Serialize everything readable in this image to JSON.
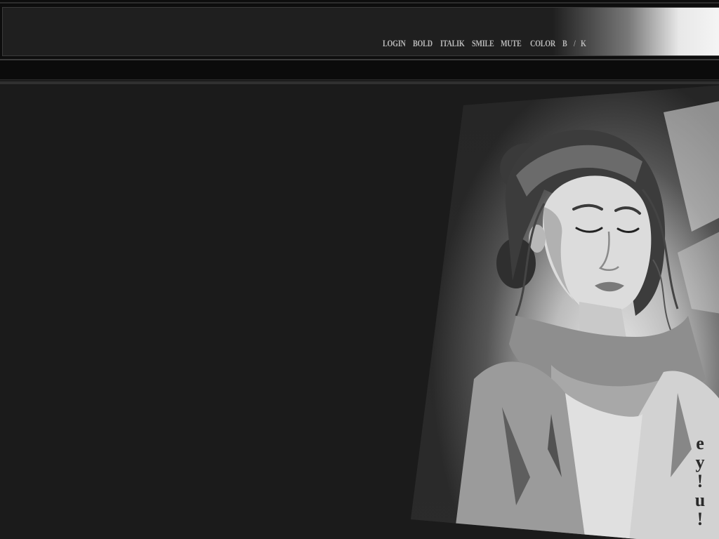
{
  "toolbar": {
    "login": "LOGIN",
    "bold": "BOLD",
    "italik": "ITALIK",
    "smile": "SMILE",
    "mute": "MUTE",
    "color": "COLOR",
    "b": "B",
    "slash": "/",
    "k": "K"
  },
  "side_text": {
    "chars": [
      "e",
      "y",
      "!",
      "u",
      "!"
    ]
  },
  "artwork": {
    "subject": "woman-illustration",
    "palette": "grayscale"
  },
  "colors": {
    "background": "#1b1b1b",
    "toolbar_text": "#b9b9b9",
    "side_text": "#2a2a2a"
  }
}
